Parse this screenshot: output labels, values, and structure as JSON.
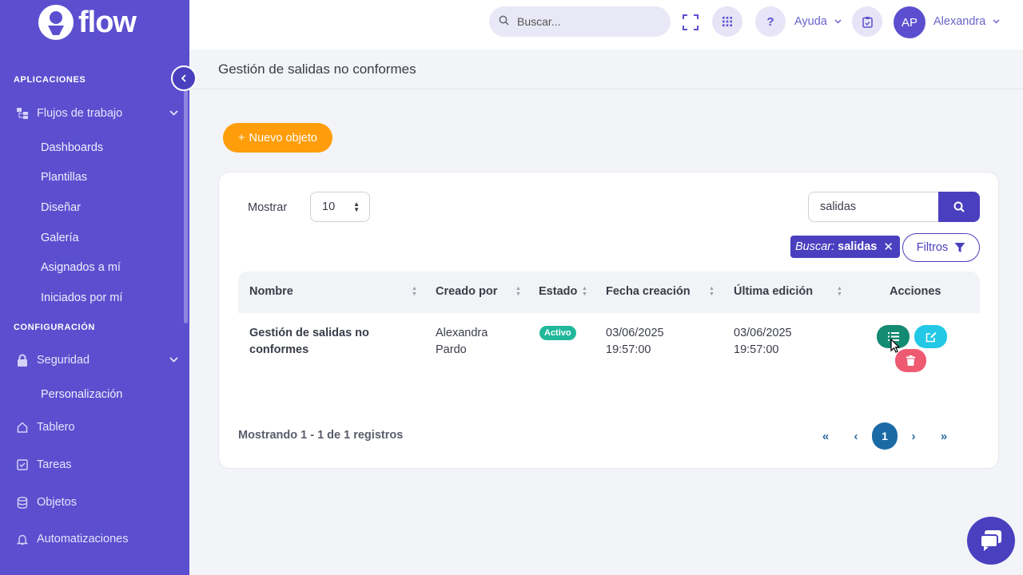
{
  "brand": {
    "name": "flow"
  },
  "sidebar": {
    "sections": {
      "apps": "APLICACIONES",
      "config": "CONFIGURACIÓN"
    },
    "workflows": {
      "label": "Flujos de trabajo",
      "icon": "sitemap-icon"
    },
    "sub_items": [
      "Dashboards",
      "Plantillas",
      "Diseñar",
      "Galería",
      "Asignados a mí",
      "Iniciados por mí"
    ],
    "security": {
      "label": "Seguridad",
      "icon": "lock-icon"
    },
    "security_sub": [
      "Personalización"
    ],
    "items": [
      {
        "label": "Tablero",
        "icon": "home-icon"
      },
      {
        "label": "Tareas",
        "icon": "checkbox-icon"
      },
      {
        "label": "Objetos",
        "icon": "database-icon"
      },
      {
        "label": "Automatizaciones",
        "icon": "bell-icon"
      }
    ]
  },
  "topbar": {
    "search_placeholder": "Buscar...",
    "help_label": "Ayuda",
    "user_initials": "AP",
    "user_name": "Alexandra"
  },
  "page": {
    "title": "Gestión de salidas no conformes",
    "new_button": "Nuevo objeto"
  },
  "table_controls": {
    "show_label": "Mostrar",
    "page_size": "10",
    "search_value": "salidas",
    "chip_prefix": "Buscar:",
    "chip_value": "salidas",
    "filters_label": "Filtros"
  },
  "table": {
    "columns": [
      "Nombre",
      "Creado por",
      "Estado",
      "Fecha creación",
      "Última edición",
      "Acciones"
    ],
    "rows": [
      {
        "name_line1": "Gestión de salidas no",
        "name_line2": "conformes",
        "creator_line1": "Alexandra",
        "creator_line2": "Pardo",
        "status": "Activo",
        "created_date": "03/06/2025",
        "created_time": "19:57:00",
        "edited_date": "03/06/2025",
        "edited_time": "19:57:00"
      }
    ]
  },
  "pagination": {
    "info": "Mostrando 1 - 1 de 1 registros",
    "first": "«",
    "prev": "‹",
    "current": "1",
    "next": "›",
    "last": "»"
  },
  "colors": {
    "sidebar": "#5b4fcf",
    "primary": "#4a3fbf",
    "new_button": "#ff9d0a",
    "status_active": "#20b89a",
    "view_button": "#138a72",
    "edit_button": "#22c8e6",
    "delete_button": "#ef5a73",
    "page_active": "#1b6aa6"
  }
}
